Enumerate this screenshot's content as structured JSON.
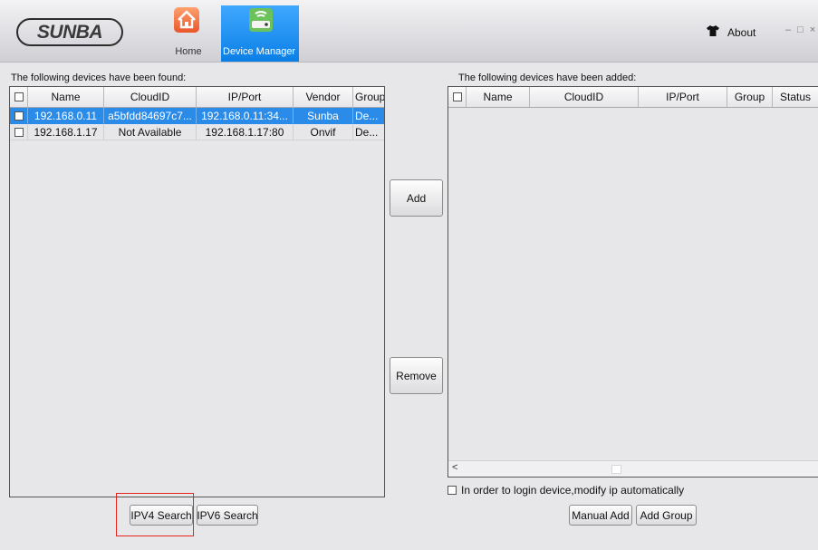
{
  "app": {
    "logo_text": "SUNBA",
    "nav": [
      {
        "label": "Home",
        "icon": "home-icon"
      },
      {
        "label": "Device Manager",
        "icon": "device-manager-icon"
      }
    ],
    "about_label": "About",
    "window_controls": "– □ ×"
  },
  "found": {
    "title": "The following devices have been found:",
    "columns": [
      "Name",
      "CloudID",
      "IP/Port",
      "Vendor",
      "Group"
    ],
    "rows": [
      {
        "name": "192.168.0.11",
        "cloudid": "a5bfdd84697c7...",
        "ipport": "192.168.0.11:34...",
        "vendor": "Sunba",
        "group": "De...",
        "selected": true
      },
      {
        "name": "192.168.1.17",
        "cloudid": "Not Available",
        "ipport": "192.168.1.17:80",
        "vendor": "Onvif",
        "group": "De...",
        "selected": false
      }
    ]
  },
  "added": {
    "title": "The following devices have been added:",
    "columns": [
      "Name",
      "CloudID",
      "IP/Port",
      "Group",
      "Status"
    ]
  },
  "actions": {
    "add": "Add",
    "remove": "Remove",
    "ipv4_search": "IPV4 Search",
    "ipv6_search": "IPV6 Search",
    "manual_add": "Manual Add",
    "add_group": "Add Group"
  },
  "options": {
    "auto_ip_label": "In order to login device,modify ip automatically",
    "auto_ip_checked": false
  },
  "colors": {
    "selection": "#2a8be8",
    "nav_active": "#0b7fe6",
    "home_icon": "#f06a3a",
    "highlight_box": "#e8221f"
  }
}
